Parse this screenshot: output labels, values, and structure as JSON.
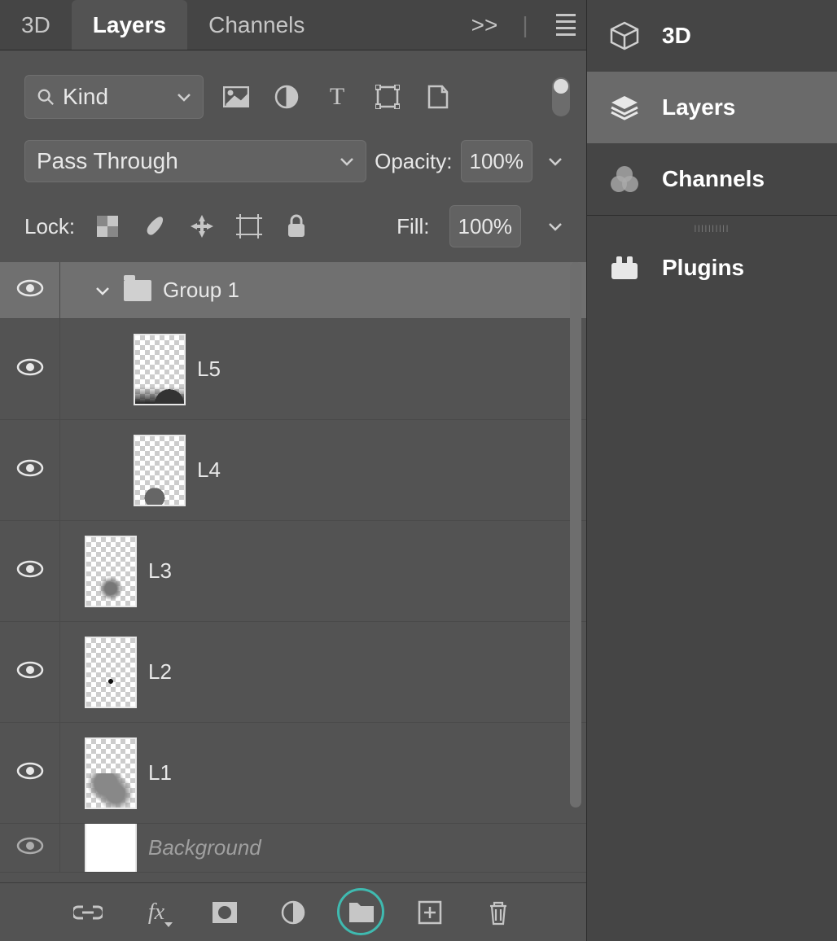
{
  "tabs": {
    "t0": "3D",
    "t1": "Layers",
    "t2": "Channels",
    "more": ">>"
  },
  "filter": {
    "kind": "Kind"
  },
  "blend": {
    "mode": "Pass Through",
    "opacity_label": "Opacity:",
    "opacity_value": "100%"
  },
  "lock": {
    "label": "Lock:",
    "fill_label": "Fill:",
    "fill_value": "100%"
  },
  "layers": {
    "group1": "Group 1",
    "l5": "L5",
    "l4": "L4",
    "l3": "L3",
    "l2": "L2",
    "l1": "L1",
    "bg": "Background"
  },
  "bottom_icons": {
    "link": "link-icon",
    "fx": "fx",
    "mask": "mask-icon",
    "adjust": "adjustment-icon",
    "folder": "group-icon",
    "new": "new-layer-icon",
    "trash": "trash-icon"
  },
  "right_panel": {
    "p0": "3D",
    "p1": "Layers",
    "p2": "Channels",
    "p3": "Plugins"
  }
}
